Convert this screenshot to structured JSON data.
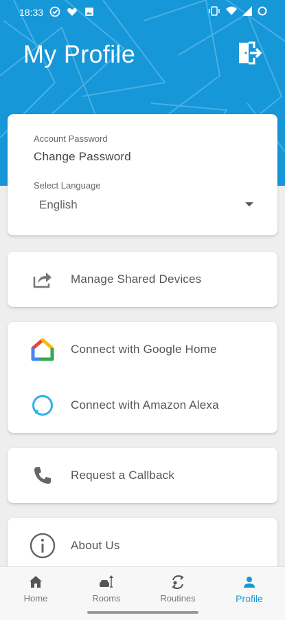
{
  "status_bar": {
    "time": "18:33",
    "left_icons": [
      "check-circle-icon",
      "heart-icon",
      "image-icon"
    ],
    "right_icons": [
      "vibrate-icon",
      "wifi-icon",
      "signal-icon",
      "battery-ring-icon"
    ]
  },
  "header": {
    "title": "My Profile",
    "background_color": "#1697d8",
    "logout_icon": "logout-icon"
  },
  "account_card": {
    "password_label": "Account Password",
    "password_action": "Change Password",
    "language_label": "Select Language",
    "language_value": "English"
  },
  "menu": {
    "manage_shared": {
      "label": "Manage Shared Devices",
      "icon": "share-icon"
    },
    "google_home": {
      "label": "Connect with Google Home",
      "icon": "google-home-icon"
    },
    "amazon_alexa": {
      "label": "Connect with Amazon Alexa",
      "icon": "alexa-icon"
    },
    "callback": {
      "label": "Request a Callback",
      "icon": "phone-icon"
    },
    "about": {
      "label": "About Us",
      "icon": "info-icon"
    }
  },
  "bottom_nav": {
    "items": [
      {
        "label": "Home",
        "icon": "home-icon"
      },
      {
        "label": "Rooms",
        "icon": "rooms-icon"
      },
      {
        "label": "Routines",
        "icon": "routines-icon"
      },
      {
        "label": "Profile",
        "icon": "person-icon"
      }
    ],
    "active_color": "#1697d8"
  }
}
